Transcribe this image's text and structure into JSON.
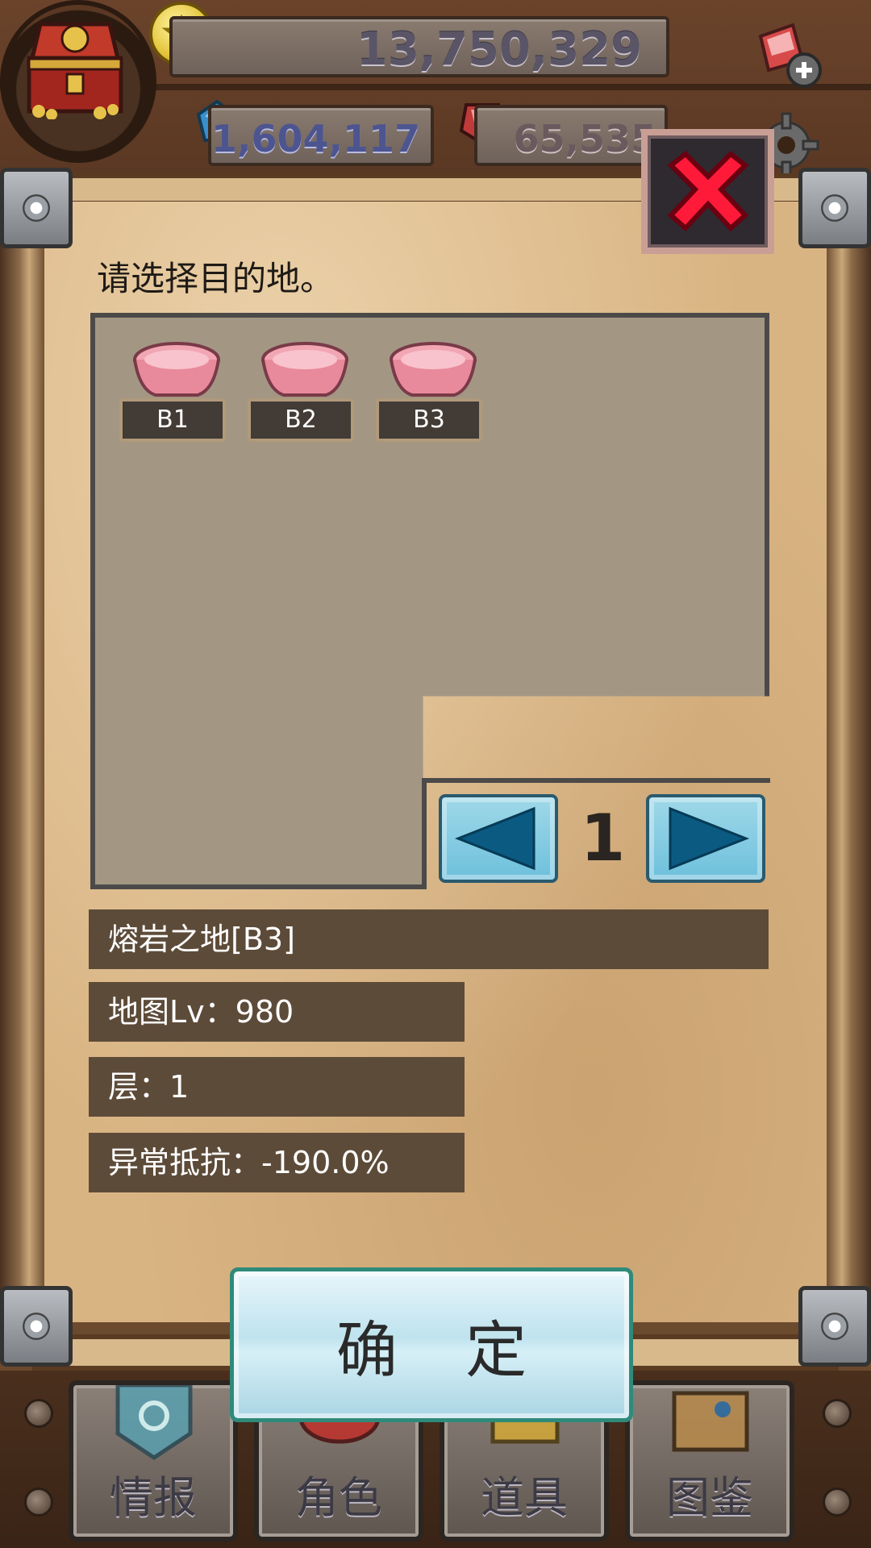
{
  "hud": {
    "gold": "13,750,329",
    "gems": "1,604,117",
    "rubies": "65,535"
  },
  "dialog": {
    "prompt": "请选择目的地。",
    "destinations": [
      {
        "label": "B1"
      },
      {
        "label": "B2"
      },
      {
        "label": "B3"
      }
    ],
    "page": "1",
    "info": {
      "name": "熔岩之地[B3]",
      "map_level": "地图Lv：980",
      "floor": "层：1",
      "status_resist": "异常抵抗：-190.0%"
    },
    "confirm_label": "确 定"
  },
  "nav": {
    "tabs": [
      {
        "label": "情报",
        "icon": "banner-icon"
      },
      {
        "label": "角色",
        "icon": "character-icon"
      },
      {
        "label": "道具",
        "icon": "items-icon"
      },
      {
        "label": "图鉴",
        "icon": "book-icon"
      }
    ]
  },
  "colors": {
    "scroll": "#d9b483",
    "grid_panel": "#a39784",
    "info_row": "#5d4b39",
    "pager_button": "#6ec0dc",
    "close_x": "#ff1a3a"
  }
}
